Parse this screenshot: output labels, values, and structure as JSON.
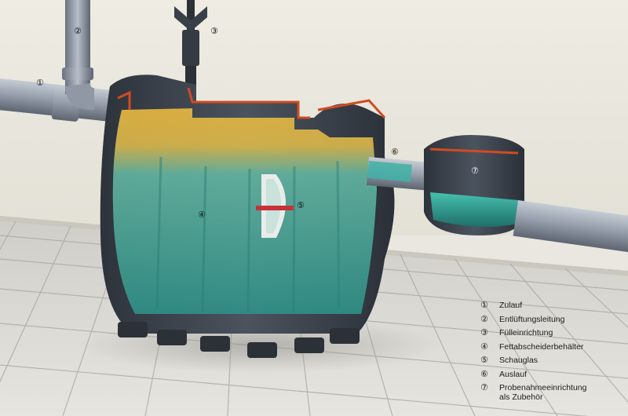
{
  "callouts": [
    {
      "id": "c1",
      "glyph": "①"
    },
    {
      "id": "c2",
      "glyph": "②"
    },
    {
      "id": "c3",
      "glyph": "③"
    },
    {
      "id": "c4",
      "glyph": "④"
    },
    {
      "id": "c5",
      "glyph": "⑤"
    },
    {
      "id": "c6",
      "glyph": "⑥"
    },
    {
      "id": "c7",
      "glyph": "⑦"
    }
  ],
  "legend": [
    {
      "num": "①",
      "text": "Zulauf"
    },
    {
      "num": "②",
      "text": "Entlüftungsleitung"
    },
    {
      "num": "③",
      "text": "Fülleinrichtung"
    },
    {
      "num": "④",
      "text": "Fettabscheiderbehälter"
    },
    {
      "num": "⑤",
      "text": "Schauglas"
    },
    {
      "num": "⑥",
      "text": "Auslauf"
    },
    {
      "num": "⑦",
      "text": "Probenahmeeinrichtung",
      "text2": "als Zubehör"
    }
  ],
  "colors": {
    "wall": "#e8e6dc",
    "floor": "#d9d8d2",
    "grout": "#9a9992",
    "pipe": "#9aa2ad",
    "tank": "#3f4650",
    "grease": "#e0b238",
    "water": "#3aa39b",
    "seal": "#d04b22"
  }
}
